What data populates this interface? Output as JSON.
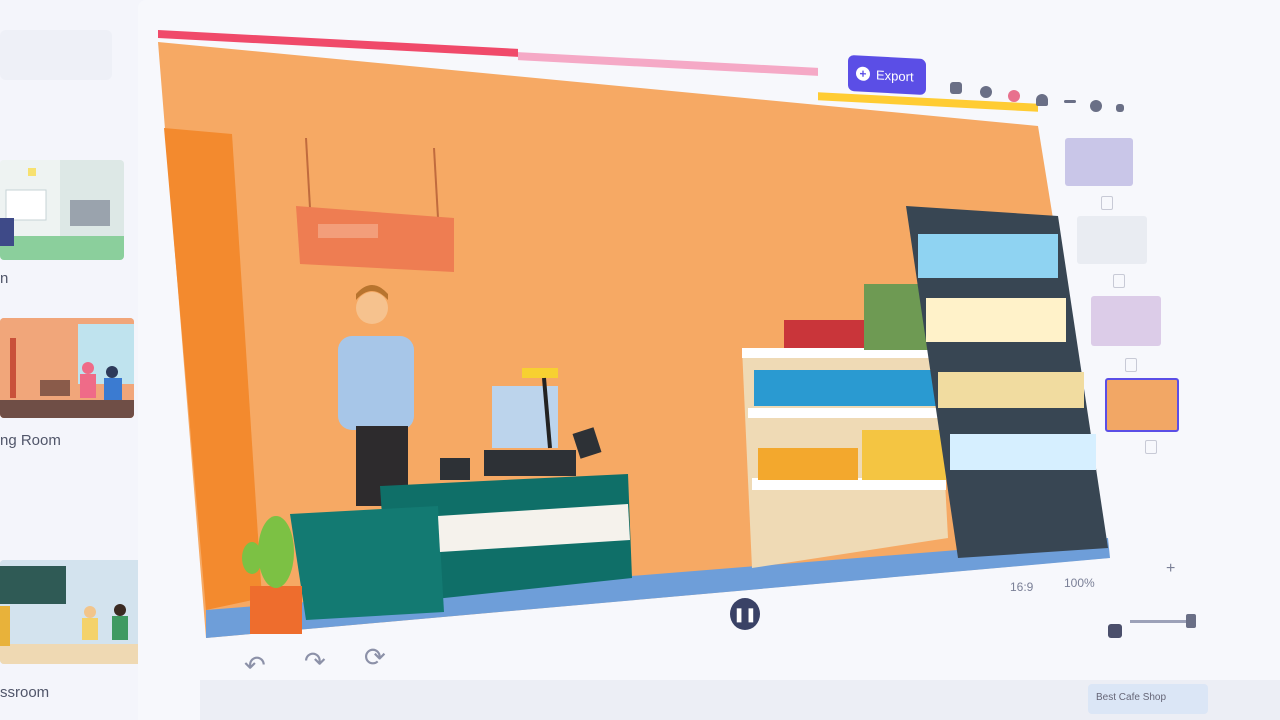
{
  "toolbar": {
    "export_label": "Export",
    "icons": [
      "save-icon",
      "print-icon",
      "record-icon",
      "user-icon",
      "minimize-icon",
      "settings-icon",
      "close-icon"
    ]
  },
  "templates": [
    {
      "label": "n"
    },
    {
      "label": "ng Room"
    },
    {
      "label": "ssroom"
    }
  ],
  "zoom": {
    "aspect": "16:9",
    "percent": "100%"
  },
  "timeline": {
    "item_label": "Best Cafe Shop"
  },
  "colors": {
    "accent": "#5b4ee6",
    "canvas_bg": "#f6a964",
    "progress_red": "#f04a6a",
    "progress_pink": "#f5a9c6",
    "progress_yellow": "#ffcc33"
  }
}
